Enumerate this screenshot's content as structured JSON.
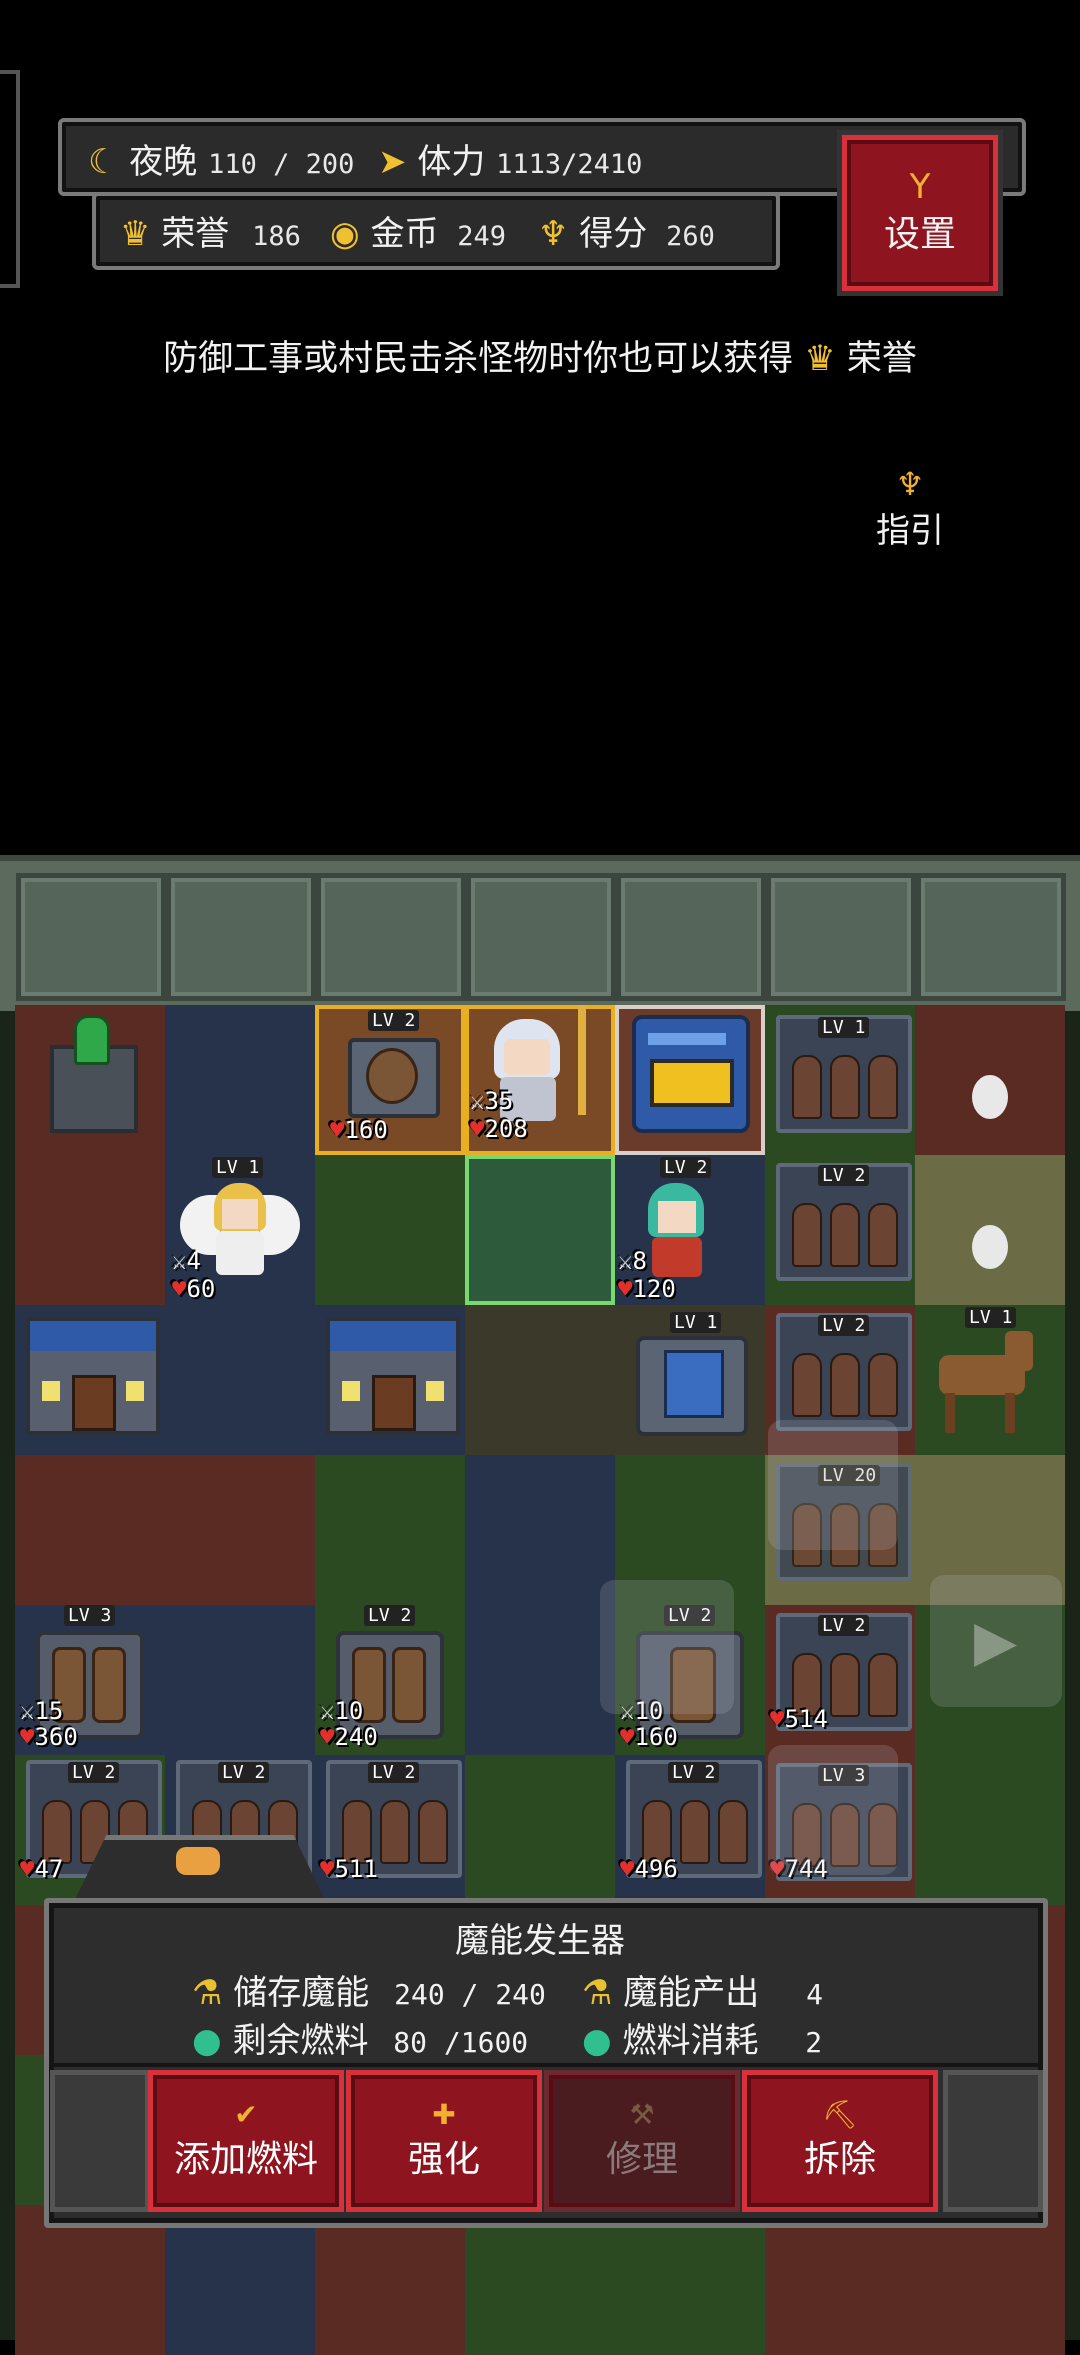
{
  "hud": {
    "night_label": "夜晚",
    "night_value": "110 / 200",
    "stamina_label": "体力",
    "stamina_value": "1113/2410",
    "honor_label": "荣誉",
    "honor_value": "186",
    "gold_label": "金币",
    "gold_value": "249",
    "score_label": "得分",
    "score_value": "260",
    "settings_label": "设置"
  },
  "tip": {
    "text": "防御工事或村民击杀怪物时你也可以获得",
    "honor_word": "荣誉"
  },
  "guide": {
    "label": "指引"
  },
  "board": {
    "units": [
      {
        "id": "mage-tower",
        "lv": "LV 2",
        "attack": null,
        "hp": "160"
      },
      {
        "id": "hero-girl",
        "lv": "",
        "attack": "35",
        "hp": "208"
      },
      {
        "id": "furnace",
        "lv": "",
        "attack": null,
        "hp": null
      },
      {
        "id": "angel",
        "lv": "LV 1",
        "attack": "4",
        "hp": "60"
      },
      {
        "id": "green-hair-girl",
        "lv": "LV 2",
        "attack": "8",
        "hp": "120"
      },
      {
        "id": "generator",
        "lv": "LV 1",
        "attack": null,
        "hp": null
      },
      {
        "id": "horse",
        "lv": "LV 1",
        "attack": null,
        "hp": null
      },
      {
        "id": "rack-a",
        "lv": "LV 1"
      },
      {
        "id": "rack-b",
        "lv": "LV 2"
      },
      {
        "id": "rack-c",
        "lv": "LV 2"
      },
      {
        "id": "rack-d",
        "lv": "LV 20"
      },
      {
        "id": "rack-e",
        "lv": "LV 2",
        "hp": "514"
      },
      {
        "id": "rack-f",
        "lv": "LV 3",
        "hp": "744"
      },
      {
        "id": "mortar-a",
        "lv": "LV 3",
        "attack": "15",
        "hp": "360"
      },
      {
        "id": "mortar-b",
        "lv": "LV 2",
        "attack": "10",
        "hp": "240"
      },
      {
        "id": "mortar-c",
        "lv": "LV 2",
        "attack": "10",
        "hp": "160"
      },
      {
        "id": "rack-g",
        "lv": "LV 2",
        "hp": "47"
      },
      {
        "id": "rack-h",
        "lv": "LV 2"
      },
      {
        "id": "rack-i",
        "lv": "LV 2",
        "hp": "511"
      },
      {
        "id": "rack-j",
        "lv": "LV 2",
        "hp": "496"
      }
    ]
  },
  "panel": {
    "title": "魔能发生器",
    "stored_label": "储存魔能",
    "stored_value": "240 / 240",
    "output_label": "魔能产出",
    "output_value": "4",
    "fuel_label": "剩余燃料",
    "fuel_value": "80 /1600",
    "consume_label": "燃料消耗",
    "consume_value": "2"
  },
  "actions": {
    "add_fuel": "添加燃料",
    "upgrade": "强化",
    "repair": "修理",
    "demolish": "拆除"
  },
  "colors": {
    "button_red": "#8e1520",
    "button_border": "#d8313c",
    "gold": "#f0b030"
  }
}
